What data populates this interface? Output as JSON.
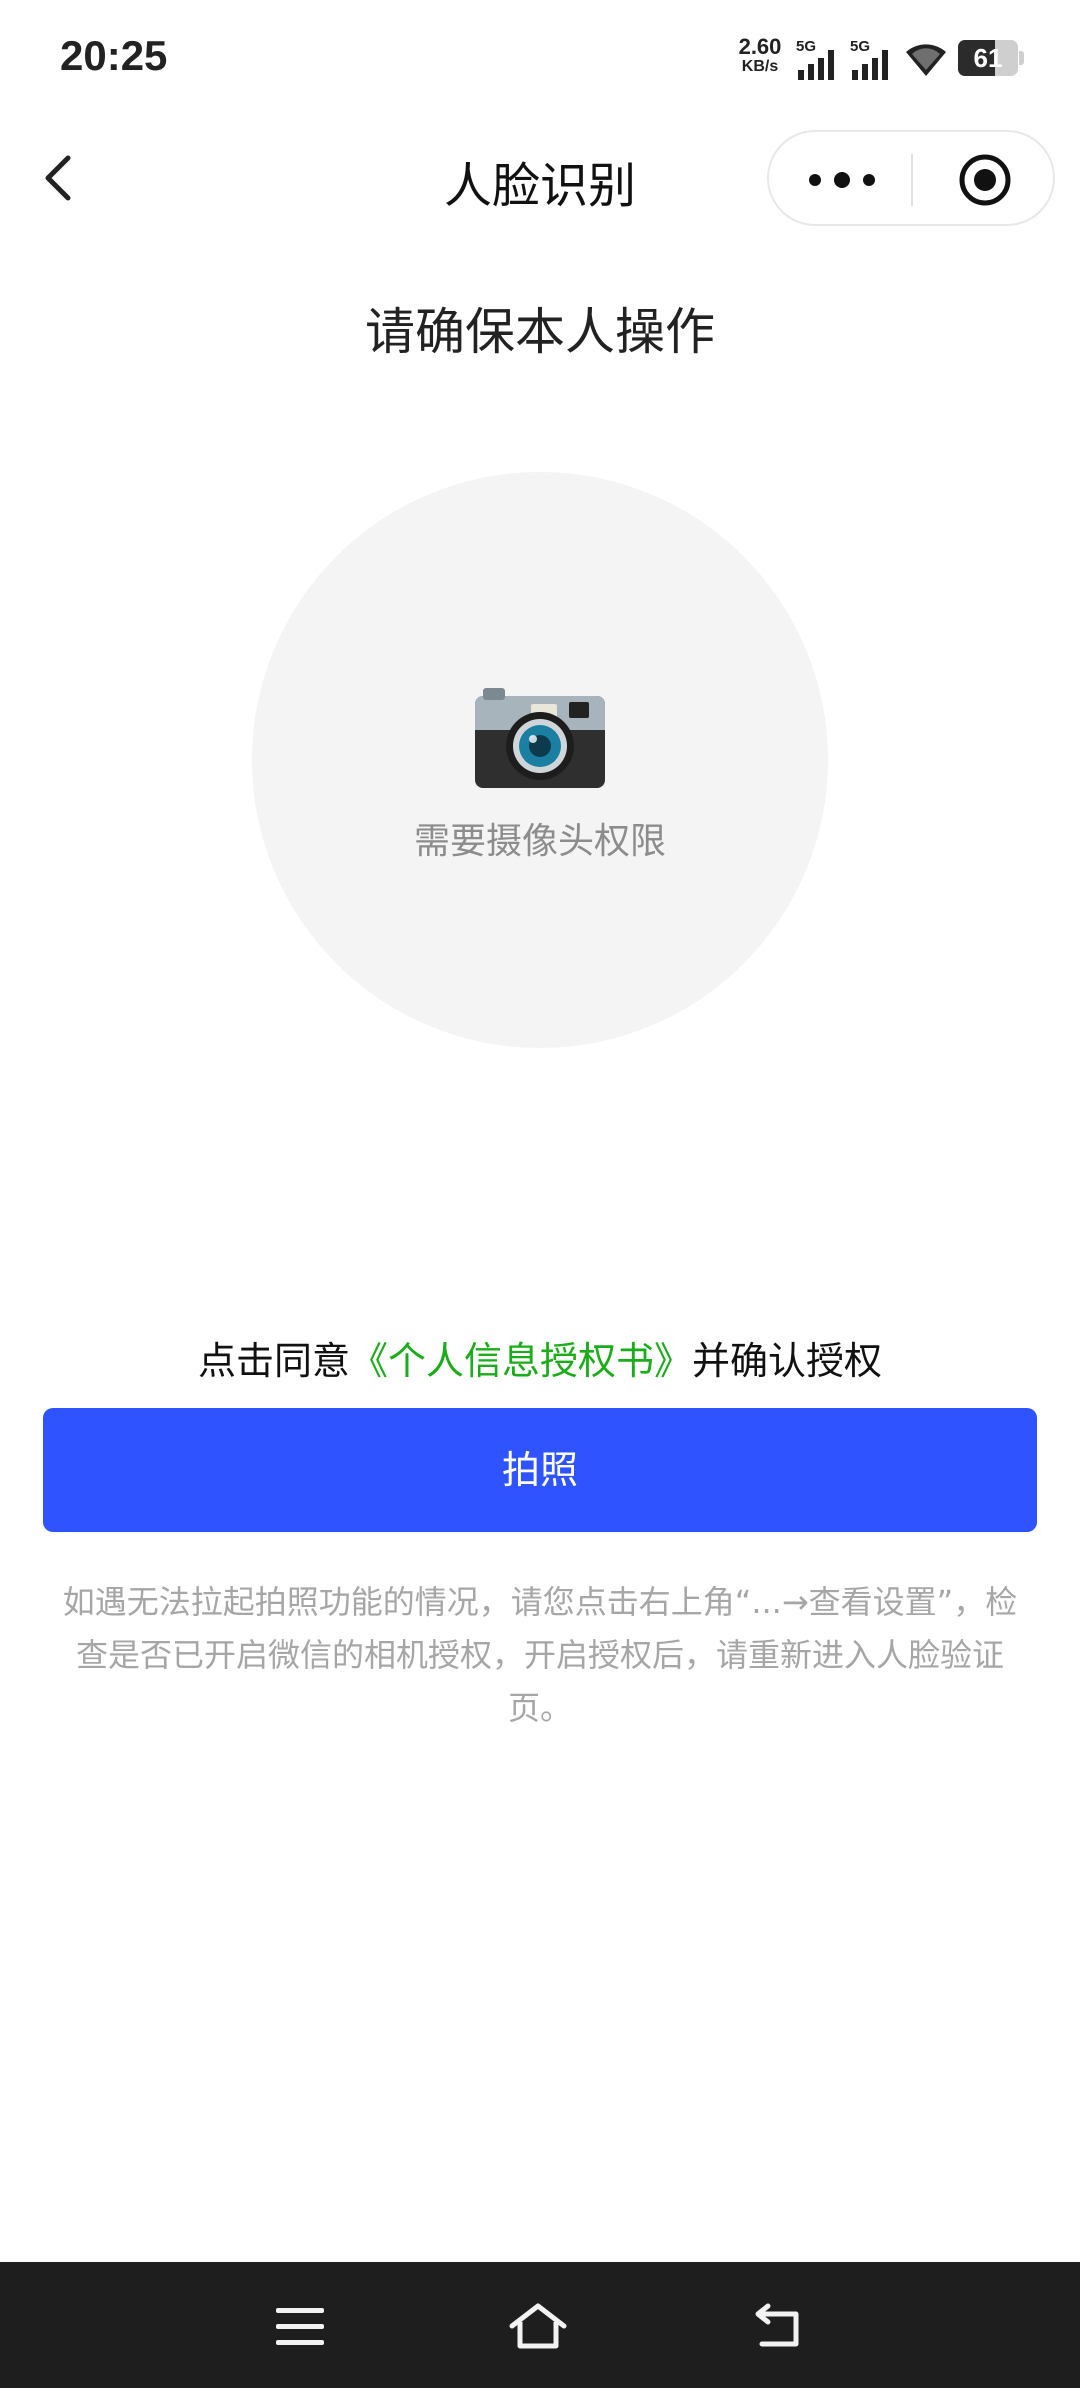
{
  "status_bar": {
    "time": "20:25",
    "net_speed_value": "2.60",
    "net_speed_unit": "KB/s",
    "signal1_label": "5G",
    "signal2_label": "5G",
    "battery": "61"
  },
  "navbar": {
    "title": "人脸识别",
    "back_icon": "chevron-left-icon",
    "more_icon": "more-dots-icon",
    "close_icon": "target-close-icon"
  },
  "content": {
    "heading": "请确保本人操作",
    "camera_icon": "camera-icon",
    "preview_text": "需要摄像头权限",
    "consent_prefix": "点击同意",
    "consent_link": "《个人信息授权书》",
    "consent_suffix": "并确认授权",
    "photo_button": "拍照",
    "help_text": "如遇无法拉起拍照功能的情况，请您点击右上角“...→查看设置”，检查是否已开启微信的相机授权，开启授权后，请重新进入人脸验证页。"
  },
  "colors": {
    "button": "#2e53ff",
    "link": "#1aad19",
    "preview_bg": "#f4f4f4",
    "sysnav_bg": "#1e1e1e"
  },
  "system_nav": {
    "menu_icon": "menu-icon",
    "home_icon": "home-icon",
    "back_icon": "back-icon"
  }
}
